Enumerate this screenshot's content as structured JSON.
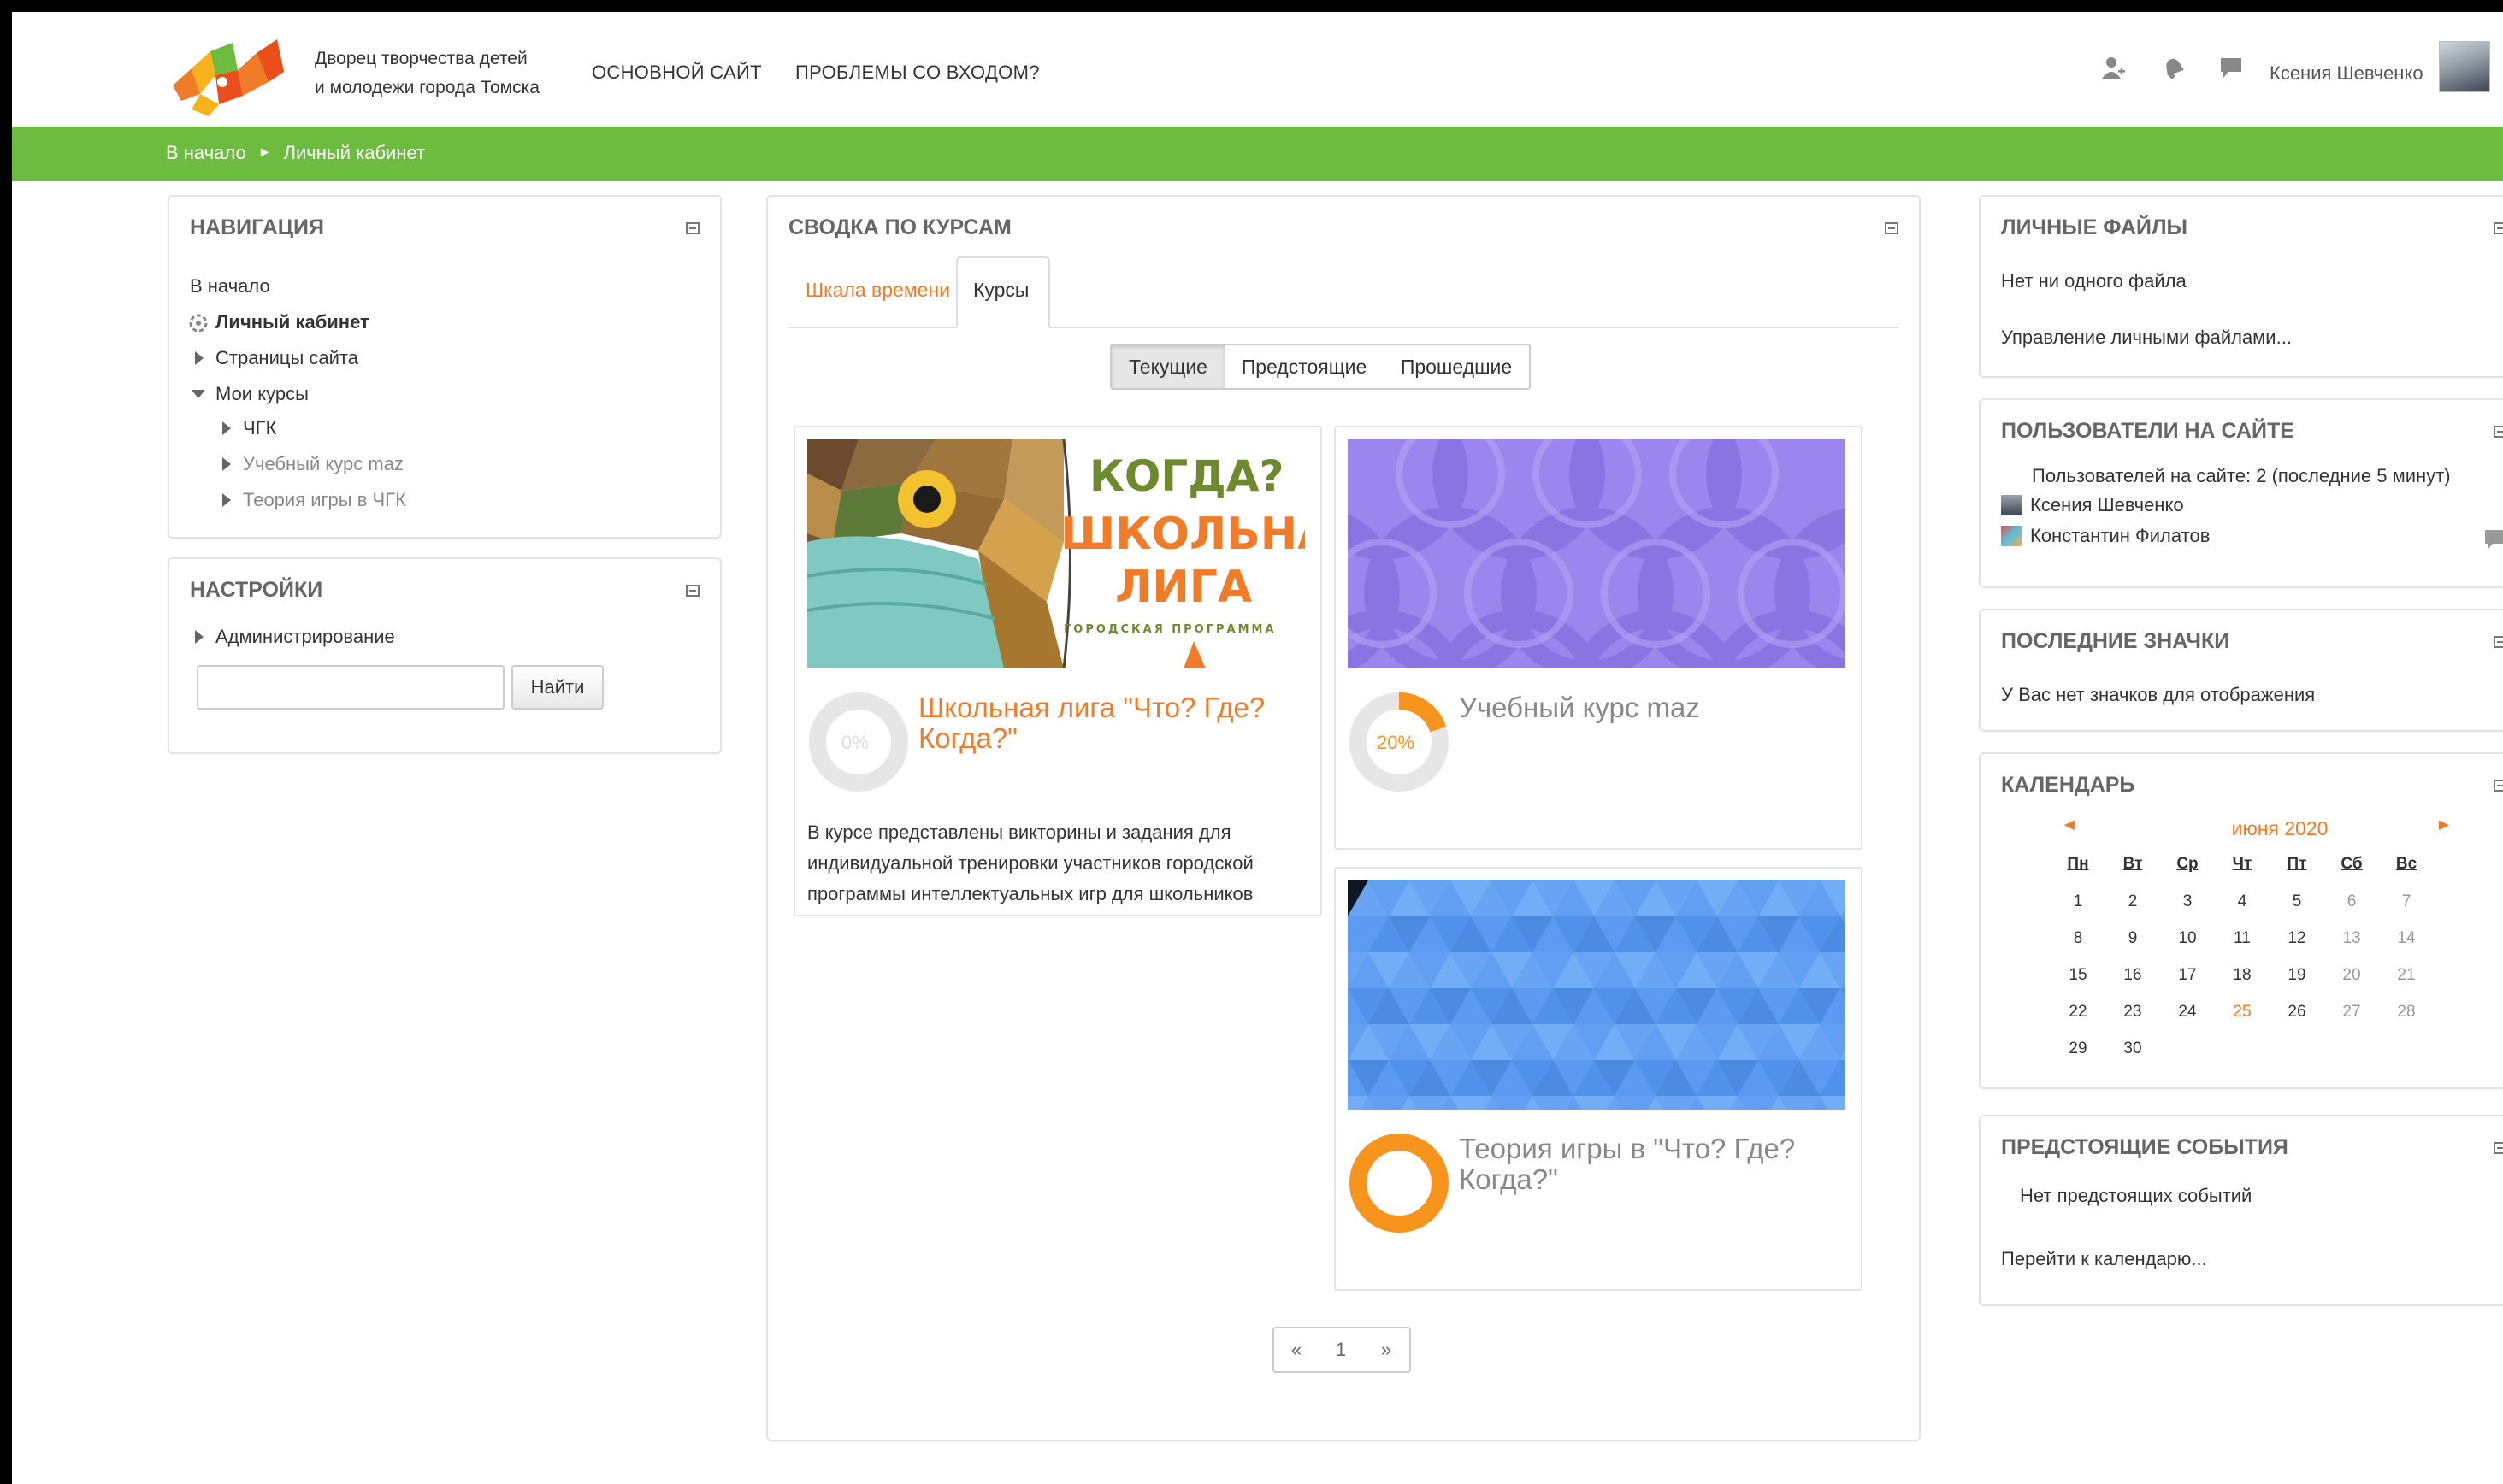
{
  "header": {
    "site_name_line1": "Дворец творчества детей",
    "site_name_line2": "и молодежи города Томска",
    "nav": [
      "ОСНОВНОЙ САЙТ",
      "ПРОБЛЕМЫ СО ВХОДОМ?"
    ],
    "user_name": "Ксения Шевченко",
    "icons": [
      "user-add-icon",
      "bell-icon",
      "chat-icon"
    ]
  },
  "breadcrumb": {
    "home": "В начало",
    "separator": "►",
    "current": "Личный кабинет"
  },
  "colors": {
    "accent": "#f07c29",
    "green": "#6dbb3f",
    "orange_ring": "#f7941d",
    "ring_track": "#e6e6e6"
  },
  "navigation": {
    "title": "НАВИГАЦИЯ",
    "home": "В начало",
    "dashboard": "Личный кабинет",
    "site_pages": "Страницы сайта",
    "my_courses": "Мои курсы",
    "courses": [
      "ЧГК",
      "Учебный курс maz",
      "Теория игры в ЧГК"
    ]
  },
  "settings": {
    "title": "НАСТРОЙКИ",
    "admin": "Администрирование",
    "search_value": "",
    "search_button": "Найти"
  },
  "overview": {
    "title": "СВОДКА ПО КУРСАМ",
    "tabs": [
      "Шкала времени",
      "Курсы"
    ],
    "active_tab": "Курсы",
    "filters": [
      "Текущие",
      "Предстоящие",
      "Прошедшие"
    ],
    "active_filter": "Текущие",
    "cards": [
      {
        "title": "Школьная лига \"Что? Где? Когда?\"",
        "progress": 0,
        "progress_label": "0%",
        "description": [
          "В курсе представлены викторины и задания для",
          "индивидуальной тренировки участников городской",
          "программы интеллектуальных игр для школьников"
        ],
        "image_text": [
          "КОГДА?",
          "ШКОЛЬНАЯ",
          "ЛИГА",
          "ГОРОДСКАЯ ПРОГРАММА"
        ]
      },
      {
        "title": "Учебный курс maz",
        "progress": 20,
        "progress_label": "20%"
      },
      {
        "title": "Теория игры в \"Что? Где? Когда?\"",
        "progress": 100,
        "progress_label": "100%"
      }
    ],
    "pagination": [
      "«",
      "1",
      "»"
    ]
  },
  "private_files": {
    "title": "ЛИЧНЫЕ ФАЙЛЫ",
    "empty": "Нет ни одного файла",
    "manage_link": "Управление личными файлами..."
  },
  "online_users": {
    "title": "ПОЛЬЗОВАТЕЛИ НА САЙТЕ",
    "summary": "Пользователей на сайте: 2 (последние 5 минут)",
    "users": [
      "Ксения Шевченко",
      "Константин Филатов"
    ]
  },
  "badges": {
    "title": "ПОСЛЕДНИЕ ЗНАЧКИ",
    "empty": "У Вас нет значков для отображения"
  },
  "calendar": {
    "title": "КАЛЕНДАРЬ",
    "month": "июня 2020",
    "prev": "◄",
    "next": "►",
    "weekdays": [
      "Пн",
      "Вт",
      "Ср",
      "Чт",
      "Пт",
      "Сб",
      "Вс"
    ],
    "weeks": [
      [
        "1",
        "2",
        "3",
        "4",
        "5",
        "6",
        "7"
      ],
      [
        "8",
        "9",
        "10",
        "11",
        "12",
        "13",
        "14"
      ],
      [
        "15",
        "16",
        "17",
        "18",
        "19",
        "20",
        "21"
      ],
      [
        "22",
        "23",
        "24",
        "25",
        "26",
        "27",
        "28"
      ],
      [
        "29",
        "30",
        "",
        "",
        "",
        "",
        ""
      ]
    ],
    "today": "25"
  },
  "upcoming": {
    "title": "ПРЕДСТОЯЩИЕ СОБЫТИЯ",
    "empty": "Нет предстоящих событий",
    "calendar_link": "Перейти к календарю..."
  }
}
